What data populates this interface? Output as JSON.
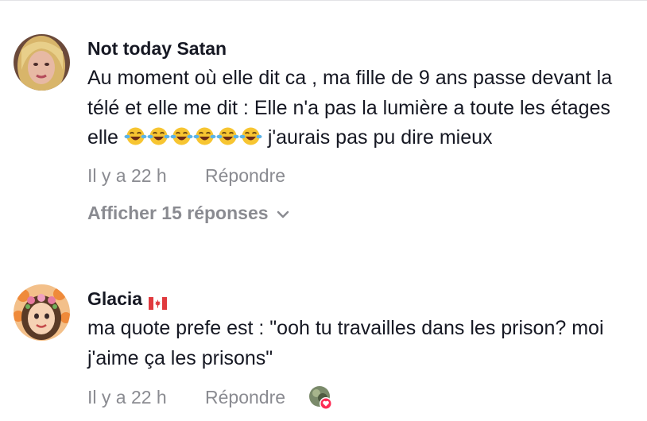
{
  "comments": [
    {
      "username": "Not today Satan",
      "text_before_emoji": "Au moment où elle dit ca , ma fille de 9 ans passe devant la télé et elle me dit : Elle n'a pas la lumière a toute les étages elle ",
      "emoji": "😂",
      "emoji_count": 6,
      "text_after_emoji": " j'aurais pas pu dire mieux",
      "time": "Il y a 22 h",
      "reply_label": "Répondre",
      "show_replies_label": "Afficher 15 réponses"
    },
    {
      "username": "Glacia",
      "flag": "canada-flag-icon",
      "text": "ma quote prefe est : \"ooh tu travailles dans les prison? moi j'aime ça les prisons\"",
      "time": "Il y a 22 h",
      "reply_label": "Répondre",
      "liked_by_creator": true
    }
  ],
  "colors": {
    "text": "#161823",
    "secondary": "#8a8b91",
    "heart": "#fe2c55"
  }
}
